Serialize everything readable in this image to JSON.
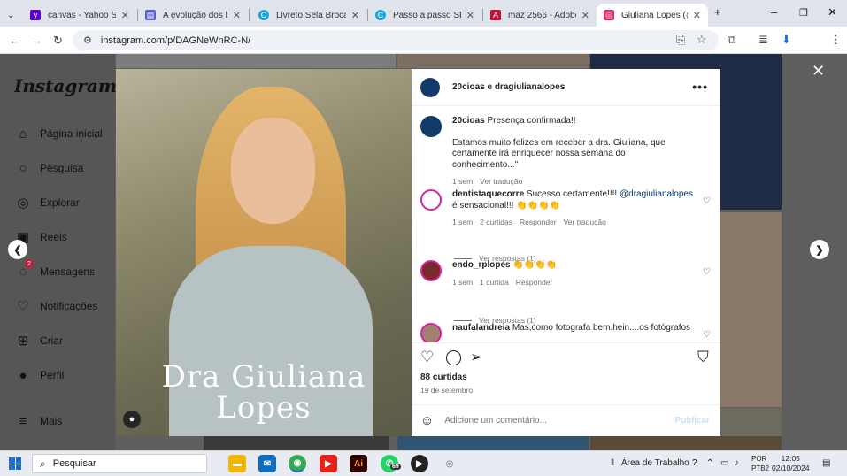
{
  "browser": {
    "tabs": [
      {
        "title": "canvas - Yahoo Searc",
        "icon": "yahoo-icon",
        "color": "#6001d2"
      },
      {
        "title": "A evolução dos broq",
        "icon": "doc-icon",
        "color": "#5b5fc7"
      },
      {
        "title": "Livreto Sela Broca.pdf",
        "icon": "canva-icon",
        "color": "#1fa4d6"
      },
      {
        "title": "Passo a passo SELA B",
        "icon": "canva-icon",
        "color": "#1fa4d6"
      },
      {
        "title": "maz 2566 - Adobe cl",
        "icon": "adobe-icon",
        "color": "#c8102e"
      },
      {
        "title": "Giuliana Lopes (@dra",
        "icon": "instagram-icon",
        "color": "#e1306c"
      }
    ],
    "url": "instagram.com/p/DAGNeWnRC-N/",
    "profile_initial": "R"
  },
  "sidebar": {
    "logo": "Instagram",
    "items": [
      {
        "label": "Página inicial",
        "icon": "home-icon",
        "glyph": "⌂"
      },
      {
        "label": "Pesquisa",
        "icon": "search-icon",
        "glyph": "○"
      },
      {
        "label": "Explorar",
        "icon": "compass-icon",
        "glyph": "◎"
      },
      {
        "label": "Reels",
        "icon": "reels-icon",
        "glyph": "▣"
      },
      {
        "label": "Mensagens",
        "icon": "messenger-icon",
        "glyph": "◌",
        "badge": "2"
      },
      {
        "label": "Notificações",
        "icon": "heart-icon",
        "glyph": "♡"
      },
      {
        "label": "Criar",
        "icon": "plus-square-icon",
        "glyph": "⊞"
      },
      {
        "label": "Perfil",
        "icon": "profile-icon",
        "glyph": "●"
      },
      {
        "label": "Mais",
        "icon": "menu-icon",
        "glyph": "≡"
      }
    ]
  },
  "post": {
    "image_text_line1": "Dra Giuliana",
    "image_text_line2": "Lopes",
    "header_title": "20cioas e dragiulianalopes",
    "caption": {
      "user": "20cioas",
      "text1": "Presença confirmada!!",
      "text2": "Estamos muito felizes em receber a dra. Giuliana, que certamente irá enriquecer nossa semana do conhecimento...\"",
      "time": "1 sem",
      "translate": "Ver tradução"
    },
    "comments": [
      {
        "user": "dentistaquecorre",
        "text": "Sucesso certamente!!!!",
        "mention": "@dragiulianalopes",
        "text_after": "é sensacional!!! 👏👏👏👏",
        "time": "1 sem",
        "likes": "2 curtidas",
        "reply": "Responder",
        "translate": "Ver tradução",
        "replies": "Ver respostas (1)"
      },
      {
        "user": "endo_rplopes",
        "text": "👏👏👏👏",
        "time": "1 sem",
        "likes": "1 curtida",
        "reply": "Responder",
        "replies": "Ver respostas (1)"
      },
      {
        "user": "naufalandreia",
        "text": "Mas,como fotografa bem.hein....os fotógrafos"
      }
    ],
    "likes_count": "88 curtidas",
    "date": "19 de setembro",
    "add_comment_placeholder": "Adicione um comentário...",
    "publish_label": "Publicar"
  },
  "taskbar": {
    "search_label": "Pesquisar",
    "desktop_label": "Área de Trabalho",
    "lang1": "POR",
    "lang2": "PTB2",
    "time": "12:05",
    "date": "02/10/2024",
    "whatsapp_badge": "69"
  }
}
